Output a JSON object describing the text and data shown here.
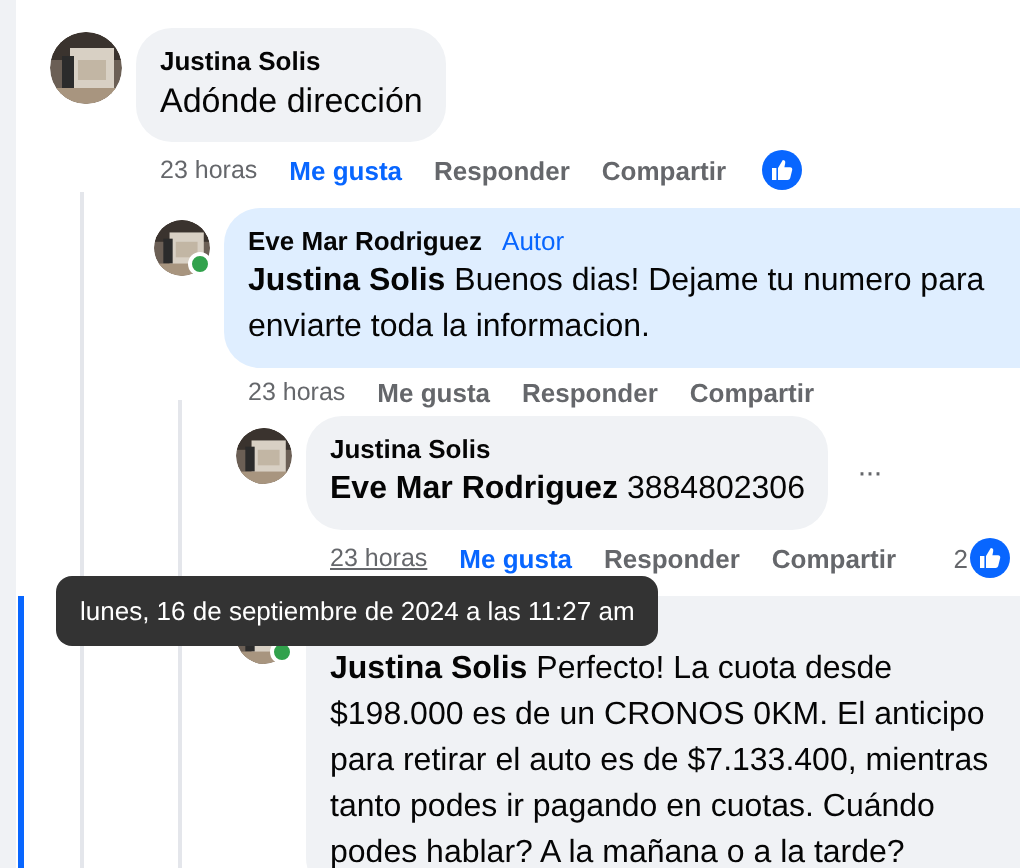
{
  "comments": [
    {
      "author": "Justina Solis",
      "text": "Adónde dirección",
      "time": "23 horas",
      "time_hovered": false,
      "like_label": "Me gusta",
      "liked": true,
      "reply_label": "Responder",
      "share_label": "Compartir",
      "reacted": true,
      "online": false,
      "from_author": false,
      "highlighted": false,
      "menu": false,
      "children": [
        {
          "author": "Eve Mar Rodriguez",
          "badge": "Autor",
          "mention": "Justina Solis",
          "text": "Buenos dias! Dejame tu numero para enviarte toda la informacion.",
          "time": "23 horas",
          "time_hovered": false,
          "like_label": "Me gusta",
          "liked": false,
          "reply_label": "Responder",
          "share_label": "Compartir",
          "reacted": false,
          "online": true,
          "from_author": true,
          "highlighted": false,
          "menu": false,
          "children": [
            {
              "author": "Justina Solis",
              "mention": "Eve Mar Rodriguez",
              "text": "3884802306",
              "time": "23 horas",
              "time_hovered": true,
              "like_label": "Me gusta",
              "liked": true,
              "reply_label": "Responder",
              "share_label": "Compartir",
              "reacted": true,
              "reaction_count": "2",
              "online": false,
              "from_author": false,
              "highlighted": false,
              "menu": true,
              "menu_label": "···"
            },
            {
              "mention": "Justina Solis",
              "text": "Perfecto! La cuota desde $198.000 es de un CRONOS 0KM. El anticipo para retirar el auto es de $7.133.400, mientras tanto podes ir pagando en cuotas. Cuándo podes hablar? A la mañana o a la tarde?",
              "online": true,
              "from_author": false,
              "highlighted": true,
              "menu": false
            }
          ]
        }
      ]
    }
  ],
  "tooltip": {
    "text": "lunes, 16 de septiembre de 2024 a las 11:27 am"
  }
}
